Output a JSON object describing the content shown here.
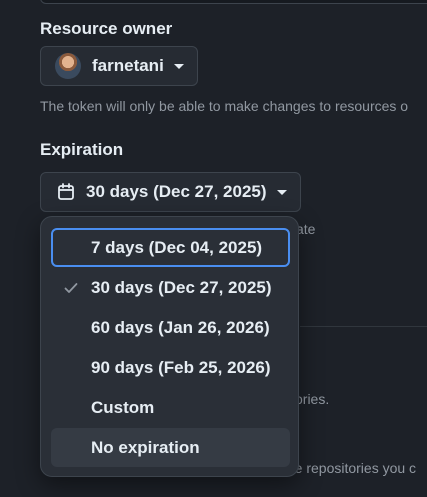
{
  "resource_owner": {
    "label": "Resource owner",
    "owner_name": "farnetani",
    "help_text": "The token will only be able to make changes to resources o"
  },
  "expiration": {
    "label": "Expiration",
    "selected_value": "30 days (Dec 27, 2025)",
    "menu_items": [
      {
        "label": "7 days (Dec 04, 2025)",
        "focused": true,
        "selected": false
      },
      {
        "label": "30 days (Dec 27, 2025)",
        "focused": false,
        "selected": true
      },
      {
        "label": "60 days (Jan 26, 2026)",
        "focused": false,
        "selected": false
      },
      {
        "label": "90 days (Feb 25, 2026)",
        "focused": false,
        "selected": false
      },
      {
        "label": "Custom",
        "focused": false,
        "selected": false
      },
      {
        "label": "No expiration",
        "focused": false,
        "selected": false,
        "hovered": true
      }
    ]
  },
  "background_fragments": {
    "fragment_1": "ate",
    "fragment_2": "ories.",
    "fragment_3": "re repositories you c"
  },
  "icons": {
    "calendar": "calendar-icon",
    "check": "check-icon",
    "caret": "triangle-down-icon",
    "avatar": "avatar"
  },
  "colors": {
    "background": "#1d2128",
    "menu_background": "#2a2f37",
    "focus_ring": "#4a8ef0",
    "muted_text": "#9198a1"
  }
}
